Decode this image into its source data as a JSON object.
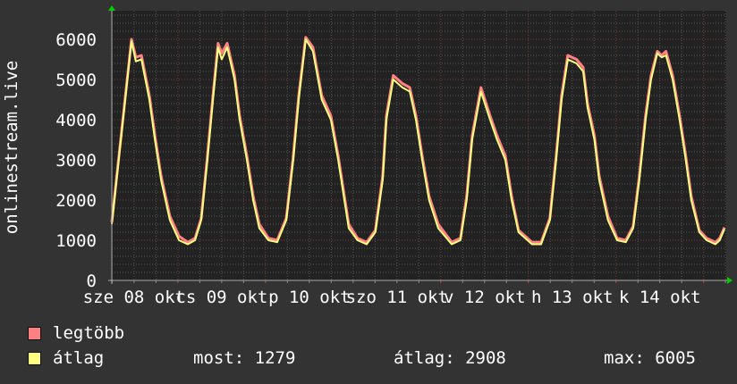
{
  "chart_data": {
    "type": "line",
    "ylabel": "onlinestream.live",
    "ylim": [
      0,
      6711
    ],
    "yticks": [
      0,
      1000,
      2000,
      3000,
      4000,
      5000,
      6000
    ],
    "xlim_hours": [
      0,
      168.3
    ],
    "first_midnight_hour": 18.1,
    "xtick_labels": [
      "sze 08 okt",
      "cs 09 okt",
      "p 10 okt",
      "szo 11 okt",
      "v 12 okt",
      "h 13 okt",
      "k 14 okt"
    ],
    "grid": true,
    "x_hours": [
      0,
      5.4,
      6.6,
      8.1,
      10.3,
      11.8,
      13.5,
      15.9,
      18.4,
      20.8,
      22.8,
      24.5,
      26.2,
      27.7,
      29.1,
      30.1,
      31.6,
      33.6,
      35.0,
      37.0,
      38.7,
      40.4,
      42.9,
      45.3,
      47.8,
      49.7,
      51.2,
      53.1,
      55.1,
      57.5,
      60.0,
      62.0,
      63.7,
      64.9,
      67.3,
      69.8,
      72.2,
      74.2,
      75.2,
      77.1,
      79.6,
      81.6,
      83.3,
      85.0,
      86.9,
      89.4,
      93.1,
      95.5,
      97.2,
      98.7,
      101.1,
      103.6,
      105.5,
      107.8,
      109.5,
      111.4,
      115.1,
      117.6,
      120.0,
      121.7,
      123.2,
      124.9,
      127.3,
      129.1,
      130.3,
      132.2,
      133.5,
      135.9,
      138.4,
      140.8,
      142.8,
      144.5,
      146.2,
      147.7,
      149.4,
      150.6,
      151.8,
      153.6,
      155.5,
      157.2,
      158.7,
      160.9,
      162.9,
      165.3,
      166.5,
      167.8
    ],
    "series": [
      {
        "name": "legtöbb",
        "color": "#ff8080",
        "values": [
          1450,
          6000,
          5550,
          5600,
          4600,
          3600,
          2600,
          1600,
          1100,
          950,
          1050,
          1550,
          3100,
          4600,
          5900,
          5650,
          5900,
          5100,
          4100,
          3100,
          2100,
          1400,
          1050,
          1000,
          1550,
          3100,
          4600,
          6050,
          5800,
          4600,
          4100,
          3100,
          2100,
          1400,
          1050,
          950,
          1250,
          2600,
          4100,
          5100,
          4900,
          4800,
          4100,
          3100,
          2100,
          1400,
          950,
          1050,
          2100,
          3600,
          4800,
          4100,
          3600,
          3100,
          2100,
          1250,
          950,
          950,
          1550,
          3100,
          4600,
          5600,
          5500,
          5300,
          4400,
          3600,
          2600,
          1600,
          1050,
          1000,
          1350,
          2600,
          4100,
          5100,
          5700,
          5600,
          5700,
          5100,
          4100,
          3100,
          2100,
          1250,
          1050,
          950,
          1050,
          1320
        ]
      },
      {
        "name": "átlag",
        "color": "#ffff80",
        "values": [
          1400,
          5950,
          5450,
          5500,
          4500,
          3500,
          2500,
          1500,
          1000,
          900,
          1000,
          1500,
          3000,
          4500,
          5800,
          5500,
          5800,
          5000,
          4000,
          3000,
          2000,
          1300,
          1000,
          950,
          1500,
          3000,
          4500,
          6000,
          5700,
          4500,
          4000,
          3000,
          2000,
          1300,
          1000,
          900,
          1200,
          2500,
          4000,
          5000,
          4800,
          4700,
          4000,
          3000,
          2000,
          1300,
          900,
          1000,
          2000,
          3500,
          4700,
          4000,
          3500,
          3000,
          2000,
          1200,
          900,
          900,
          1500,
          3000,
          4500,
          5500,
          5400,
          5200,
          4300,
          3500,
          2500,
          1500,
          1000,
          950,
          1300,
          2500,
          4000,
          5000,
          5650,
          5550,
          5600,
          5000,
          4000,
          3000,
          2000,
          1200,
          1000,
          900,
          1000,
          1279
        ]
      }
    ]
  },
  "legend": {
    "max_label": "legtöbb",
    "avg_label": "átlag",
    "now": "most: 1279",
    "average": "átlag: 2908",
    "maximum": "max: 6005"
  }
}
